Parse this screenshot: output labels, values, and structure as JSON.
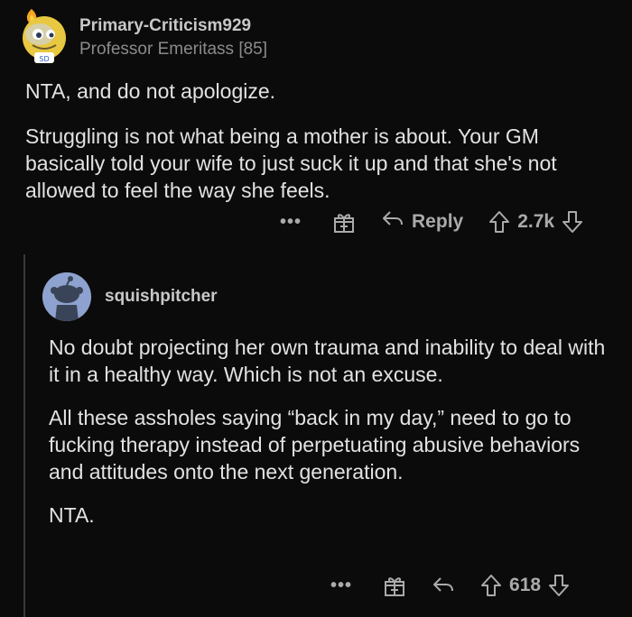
{
  "comment": {
    "username": "Primary-Criticism929",
    "flair": "Professor Emeritass [85]",
    "paragraphs": [
      "NTA, and do not apologize.",
      "Struggling is not what being a mother is about. Your GM basically told your wife to just suck it up and that she's not allowed to feel the way she feels."
    ],
    "actions": {
      "more": "•••",
      "reply_label": "Reply",
      "score": "2.7k"
    }
  },
  "reply": {
    "username": "squishpitcher",
    "paragraphs": [
      "No doubt projecting her own trauma and inability to deal with it in a healthy way. Which is not an excuse.",
      "All these assholes saying “back in my day,” need to go to fucking therapy instead of perpetuating abusive behaviors and attitudes onto the next generation.",
      "NTA."
    ],
    "actions": {
      "more": "•••",
      "score": "618"
    }
  },
  "colors": {
    "background": "#0b0b0b",
    "text": "#e2e2e2",
    "muted": "#8b8b8b",
    "avatar_bg": "#8ea2cf"
  },
  "icons": [
    "award-gift-icon",
    "reply-arrow-icon",
    "upvote-icon",
    "downvote-icon",
    "more-dots-icon"
  ]
}
